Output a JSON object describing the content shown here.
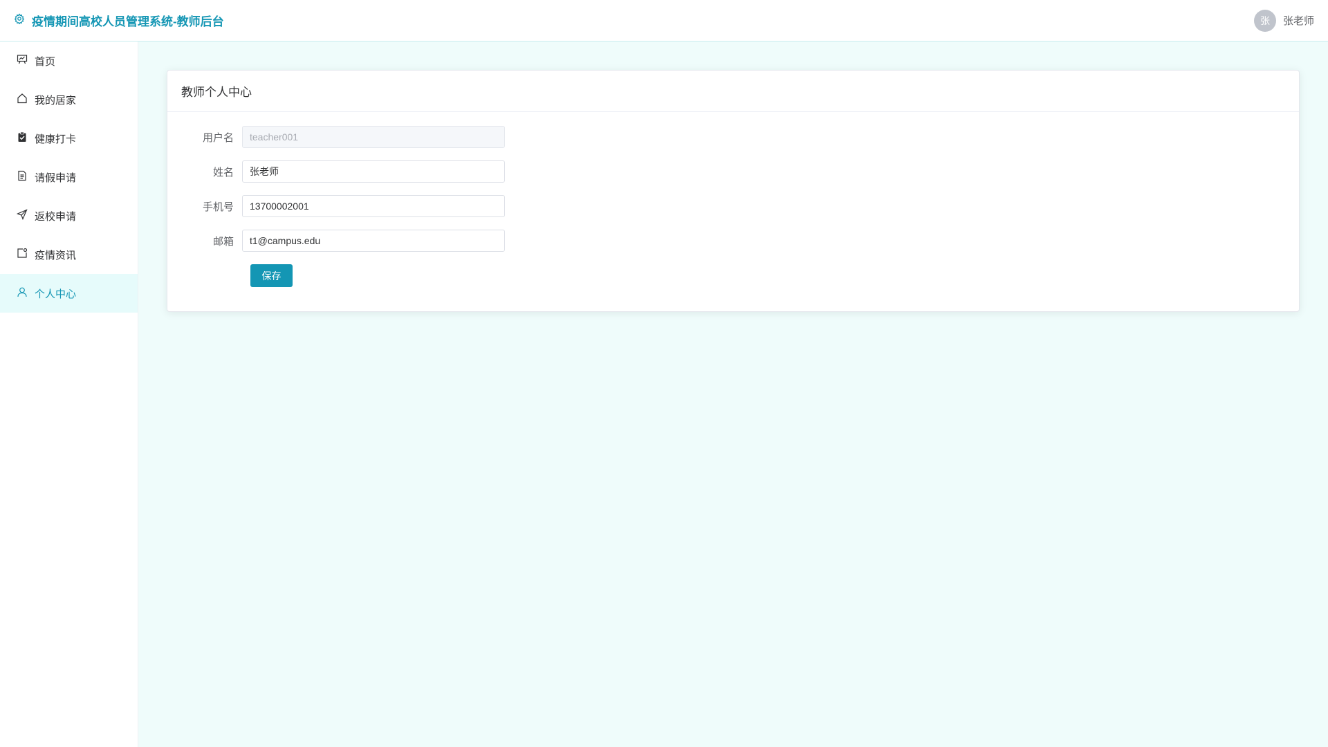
{
  "header": {
    "title": "疫情期间高校人员管理系统-教师后台",
    "brand_icon": "gear-icon",
    "avatar_text": "张",
    "username": "张老师"
  },
  "sidebar": {
    "items": [
      {
        "label": "首页",
        "icon": "presentation-board-icon",
        "active": false
      },
      {
        "label": "我的居家",
        "icon": "house-icon",
        "active": false
      },
      {
        "label": "健康打卡",
        "icon": "clipboard-check-icon",
        "active": false
      },
      {
        "label": "请假申请",
        "icon": "document-icon",
        "active": false
      },
      {
        "label": "返校申请",
        "icon": "paper-plane-icon",
        "active": false
      },
      {
        "label": "疫情资讯",
        "icon": "notification-icon",
        "active": false
      },
      {
        "label": "个人中心",
        "icon": "user-icon",
        "active": true
      }
    ]
  },
  "main": {
    "card_title": "教师个人中心",
    "form": {
      "username_label": "用户名",
      "username_value": "teacher001",
      "name_label": "姓名",
      "name_value": "张老师",
      "phone_label": "手机号",
      "phone_value": "13700002001",
      "email_label": "邮箱",
      "email_value": "t1@campus.edu",
      "save_label": "保存"
    }
  },
  "colors": {
    "accent": "#1496b4",
    "main_bg": "#effcfb",
    "active_menu_bg": "#e6fbfb"
  }
}
